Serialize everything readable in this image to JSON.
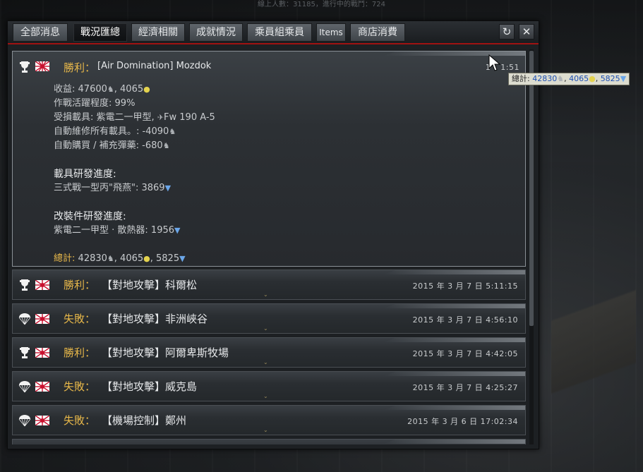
{
  "status_bar": {
    "text": "線上人數：31185，進行中的戰鬥：724"
  },
  "tabs": [
    {
      "label": "全部消息"
    },
    {
      "label": "戰況匯總"
    },
    {
      "label": "經濟相關"
    },
    {
      "label": "成就情況"
    },
    {
      "label": "乘員組乘員"
    },
    {
      "label": "Items"
    },
    {
      "label": "商店消費"
    }
  ],
  "active_tab": "戰況匯總",
  "toolbar": {
    "refresh_icon": "refresh-icon",
    "close_icon": "close-icon"
  },
  "expanded_entry": {
    "result": "勝利",
    "mission": "[Air Domination] Mozdok",
    "time": "1",
    "time_tail": "1:51",
    "income_label": "收益",
    "income_silver": "47600",
    "income_rp": "4065",
    "activity_label": "作戰活躍程度",
    "activity_value": "99%",
    "damaged_label": "受損載具",
    "damaged_vehicle1": "紫電二一甲型",
    "damaged_vehicle2": "Fw 190 A-5",
    "repair_label": "自動維修所有載具。",
    "repair_value": "-4090",
    "ammo_label": "自動購買 / 補充彈藥",
    "ammo_value": "-680",
    "research_head": "載具研發進度",
    "research_item": "三式戰一型丙\"飛燕\"",
    "research_value": "3869",
    "mod_head": "改裝件研發進度",
    "mod_item": "紫電二一甲型 · 散熱器",
    "mod_value": "1956",
    "total_label": "總計",
    "total_silver": "42830",
    "total_rp": "4065",
    "total_gold": "5825"
  },
  "entries": [
    {
      "result": "勝利",
      "icon": "trophy-icon",
      "mission": "【對地攻擊】科爾松",
      "date": "2015 年 3 月 7 日 5:11:15"
    },
    {
      "result": "失敗",
      "icon": "parachute-icon",
      "mission": "【對地攻擊】非洲峽谷",
      "date": "2015 年 3 月 7 日 4:56:10"
    },
    {
      "result": "勝利",
      "icon": "trophy-icon",
      "mission": "【對地攻擊】阿爾卑斯牧場",
      "date": "2015 年 3 月 7 日 4:42:05"
    },
    {
      "result": "失敗",
      "icon": "parachute-icon",
      "mission": "【對地攻擊】威克島",
      "date": "2015 年 3 月 7 日 4:25:27"
    },
    {
      "result": "失敗",
      "icon": "parachute-icon",
      "mission": "【機場控制】鄭州",
      "date": "2015 年 3 月 6 日 17:02:34"
    }
  ],
  "tooltip": {
    "label": "總計",
    "silver": "42830",
    "rp": "4065",
    "gold": "5825"
  },
  "colors": {
    "accent_red": "#a01212",
    "result_gold": "#e8b84a",
    "research_blue": "#6ba6e8",
    "rp_yellow": "#e3d24e"
  }
}
